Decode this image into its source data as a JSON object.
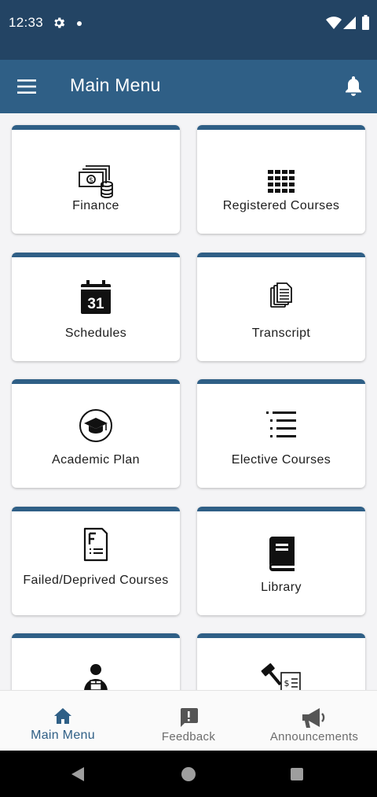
{
  "status_bar": {
    "time": "12:33"
  },
  "app_bar": {
    "title": "Main Menu"
  },
  "menu": {
    "items": [
      {
        "label": "Finance",
        "icon": "cash-icon"
      },
      {
        "label": "Registered Courses",
        "icon": "grid-icon"
      },
      {
        "label": "Schedules",
        "icon": "calendar-icon",
        "calendar_day": "31"
      },
      {
        "label": "Transcript",
        "icon": "documents-icon"
      },
      {
        "label": "Academic Plan",
        "icon": "graduation-cap-icon"
      },
      {
        "label": "Elective Courses",
        "icon": "list-icon"
      },
      {
        "label": "Failed/Deprived Courses",
        "icon": "document-f-icon"
      },
      {
        "label": "Library",
        "icon": "book-icon"
      },
      {
        "label": "",
        "icon": "person-package-icon"
      },
      {
        "label": "",
        "icon": "gavel-invoice-icon"
      }
    ]
  },
  "bottom_nav": {
    "items": [
      {
        "label": "Main Menu",
        "icon": "home-icon",
        "active": true
      },
      {
        "label": "Feedback",
        "icon": "feedback-icon",
        "active": false
      },
      {
        "label": "Announcements",
        "icon": "megaphone-icon",
        "active": false
      }
    ]
  },
  "colors": {
    "status_bar": "#234464",
    "app_bar": "#2f5f86",
    "accent": "#2f5f86",
    "background": "#f4f4f6"
  }
}
